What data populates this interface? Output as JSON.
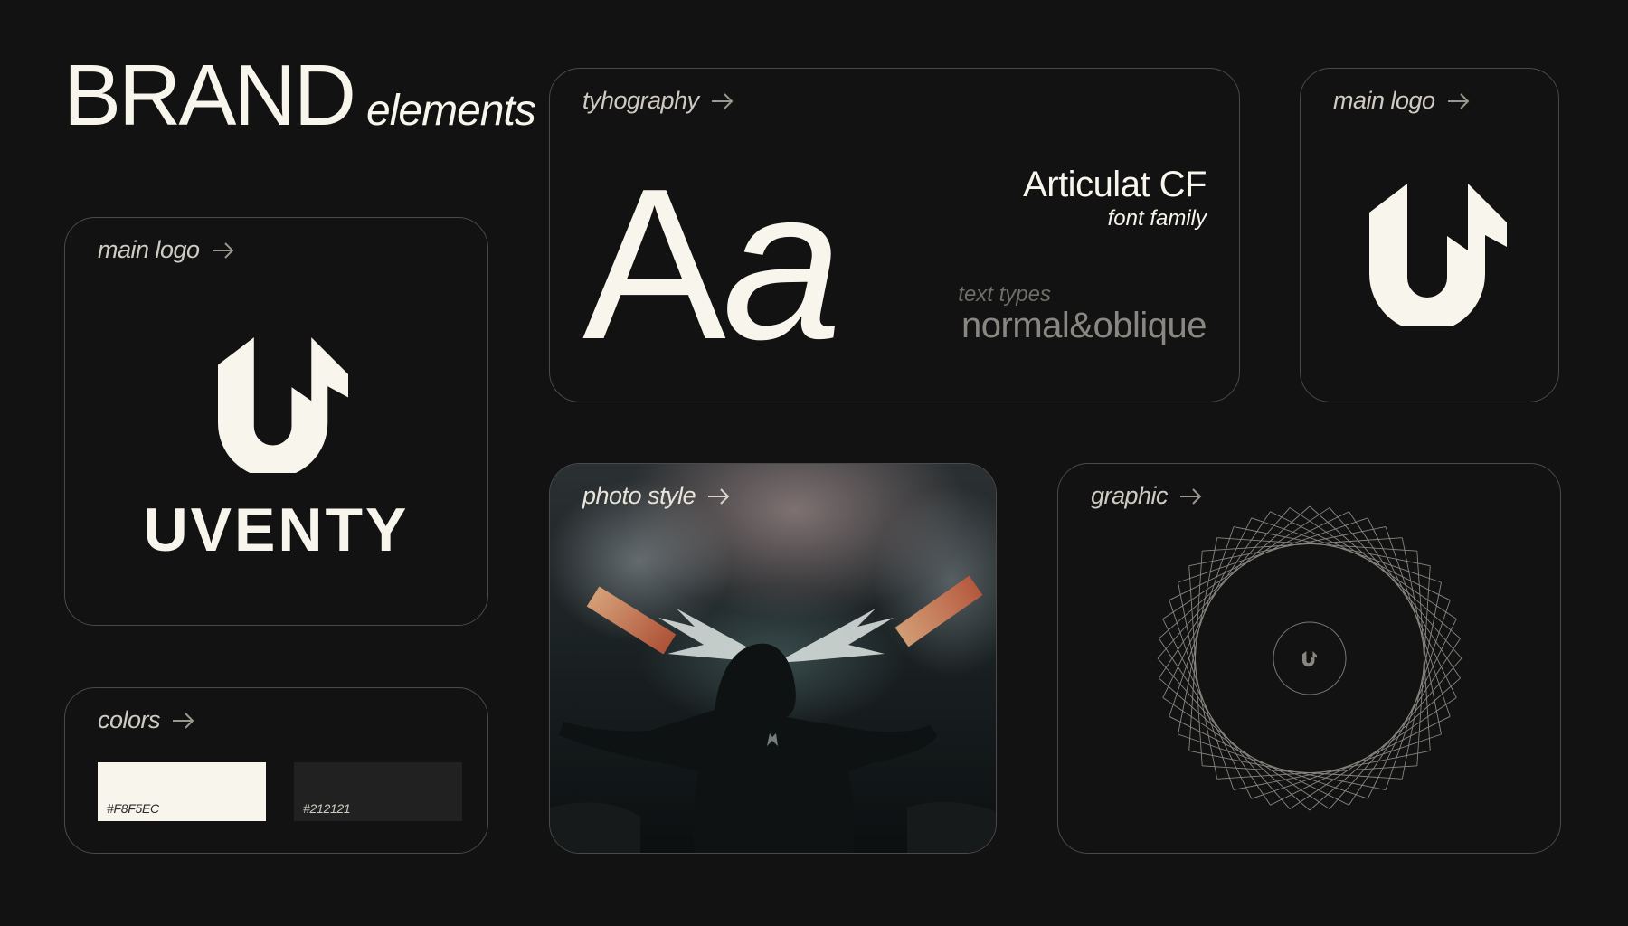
{
  "title": {
    "main": "BRAND",
    "sub": "elements"
  },
  "cards": {
    "typography": {
      "label": "tyhography",
      "sample": "Aa",
      "sample_upper": "A",
      "sample_lower": "a",
      "font_name": "Articulat CF",
      "font_name_caption": "font family",
      "text_types_label": "text types",
      "text_types_value": "normal&oblique"
    },
    "logo_small": {
      "label": "main logo"
    },
    "logo_large": {
      "label": "main logo",
      "wordmark": "UVENTY"
    },
    "colors": {
      "label": "colors",
      "swatches": [
        {
          "hex": "#F8F5EC",
          "label": "#F8F5EC"
        },
        {
          "hex": "#212121",
          "label": "#212121"
        }
      ]
    },
    "photo": {
      "label": "photo style"
    },
    "graphic": {
      "label": "graphic"
    }
  },
  "icons": {
    "arrow": "arrow-right-icon",
    "logo": "uventy-logo-icon"
  },
  "colors": {
    "background": "#121212",
    "foreground": "#F8F5EC",
    "border": "#4a4a4a"
  }
}
